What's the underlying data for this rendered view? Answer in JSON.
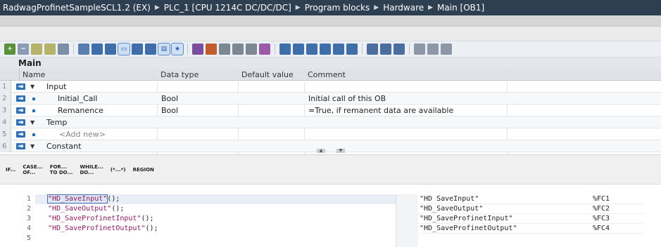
{
  "breadcrumb": [
    "RadwagProfinetSampleSCL1.2 (EX)",
    "PLC_1 [CPU 1214C DC/DC/DC]",
    "Program blocks",
    "Hardware",
    "Main [OB1]"
  ],
  "breadcrumb_sep": "▶",
  "block_title": "Main",
  "interface": {
    "columns": {
      "name": "Name",
      "datatype": "Data type",
      "default": "Default value",
      "comment": "Comment"
    },
    "rows": [
      {
        "num": "1",
        "kind": "section",
        "name": "Input",
        "datatype": "",
        "comment": ""
      },
      {
        "num": "2",
        "kind": "var",
        "name": "Initial_Call",
        "datatype": "Bool",
        "comment": "Initial call of this OB"
      },
      {
        "num": "3",
        "kind": "var",
        "name": "Remanence",
        "datatype": "Bool",
        "comment": "=True, if remanent data are available"
      },
      {
        "num": "4",
        "kind": "section",
        "name": "Temp",
        "datatype": "",
        "comment": ""
      },
      {
        "num": "5",
        "kind": "add",
        "name": "<Add new>",
        "datatype": "",
        "comment": ""
      },
      {
        "num": "6",
        "kind": "section",
        "name": "Constant",
        "datatype": "",
        "comment": ""
      }
    ]
  },
  "scl_buttons": [
    {
      "label": "IF..."
    },
    {
      "label": "CASE...\nOF..."
    },
    {
      "label": "FOR...\nTO DO..."
    },
    {
      "label": "WHILE...\nDO..."
    },
    {
      "label": "(*...*)"
    },
    {
      "label": "REGION"
    }
  ],
  "code_lines": [
    {
      "num": "1",
      "name": "\"HD_SaveInput\"",
      "rest": "();"
    },
    {
      "num": "2",
      "name": "\"HD_SaveOutput\"",
      "rest": "();"
    },
    {
      "num": "3",
      "name": "\"HD_SaveProfinetInput\"",
      "rest": "();"
    },
    {
      "num": "4",
      "name": "\"HD_SaveProfinetOutput\"",
      "rest": "();"
    },
    {
      "num": "5",
      "name": "",
      "rest": ""
    }
  ],
  "xrefs": [
    {
      "name": "\"HD SaveInput\"",
      "addr": "%FC1"
    },
    {
      "name": "\"HD_SaveOutput\"",
      "addr": "%FC2"
    },
    {
      "name": "\"HD_SaveProfinetInput\"",
      "addr": "%FC3"
    },
    {
      "name": "\"HD_SaveProfinetOutput\"",
      "addr": "%FC4"
    }
  ],
  "colors": {
    "titlebar": "#2f3f52",
    "interface_icon": "#2e6fb6",
    "code_name": "#8b1a60"
  }
}
